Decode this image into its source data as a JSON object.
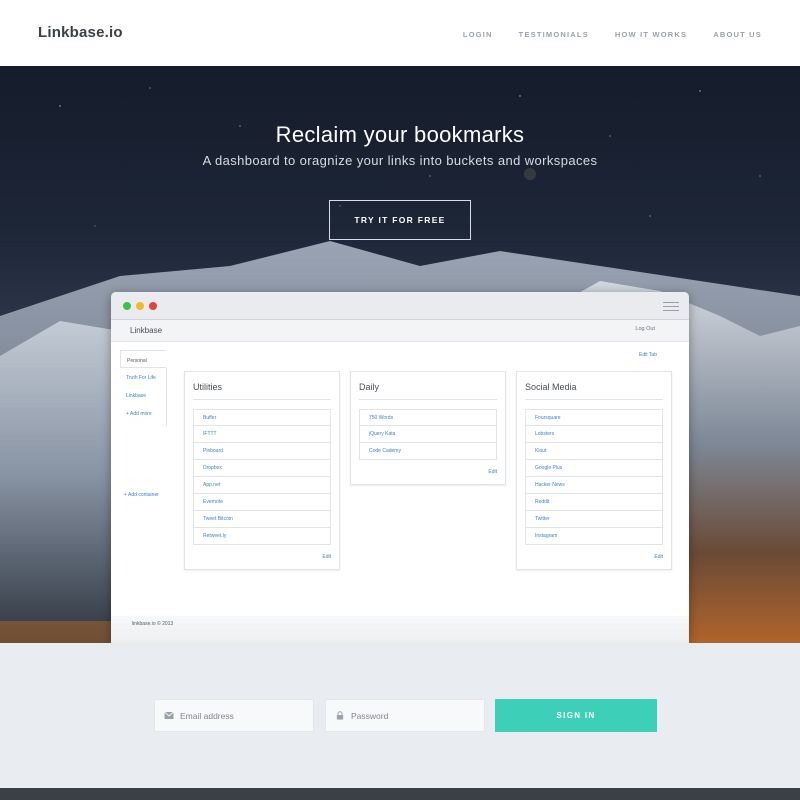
{
  "nav": {
    "logo": "Linkbase.io",
    "links": [
      "LOGIN",
      "TESTIMONIALS",
      "HOW IT WORKS",
      "ABOUT US"
    ]
  },
  "hero": {
    "title": "Reclaim your bookmarks",
    "subtitle": "A dashboard to oragnize your links into buckets and workspaces",
    "cta": "TRY IT FOR FREE"
  },
  "app": {
    "name": "Linkbase",
    "logout": "Log Out",
    "edit_tab": "Edit Tab",
    "sidebar": [
      "Personal",
      "Truth For Life",
      "Linkbase",
      "+ Add more"
    ],
    "add_container": "+ Add container",
    "cards": [
      {
        "title": "Utilities",
        "links": [
          "Buffer",
          "IFTTT",
          "Pinboard",
          "Dropbox",
          "App.net",
          "Evernote",
          "Tweet Bitcoin",
          "Retweet.ly"
        ],
        "edit": "Edit"
      },
      {
        "title": "Daily",
        "links": [
          "750 Words",
          "jQuery Kata",
          "Code Cademy"
        ],
        "edit": "Edit"
      },
      {
        "title": "Social Media",
        "links": [
          "Foursquare",
          "Lobsters",
          "Klout",
          "Google Plus",
          "Hacker News",
          "Reddit",
          "Twitter",
          "Instagram"
        ],
        "edit": "Edit"
      }
    ],
    "footer": "linkbase.io © 2013"
  },
  "signup": {
    "email_placeholder": "Email address",
    "password_placeholder": "Password",
    "button": "SIGN IN"
  },
  "colors": {
    "accent": "#3ecfb8",
    "link": "#3d82c7",
    "bottom_bar": "#3b4046"
  }
}
